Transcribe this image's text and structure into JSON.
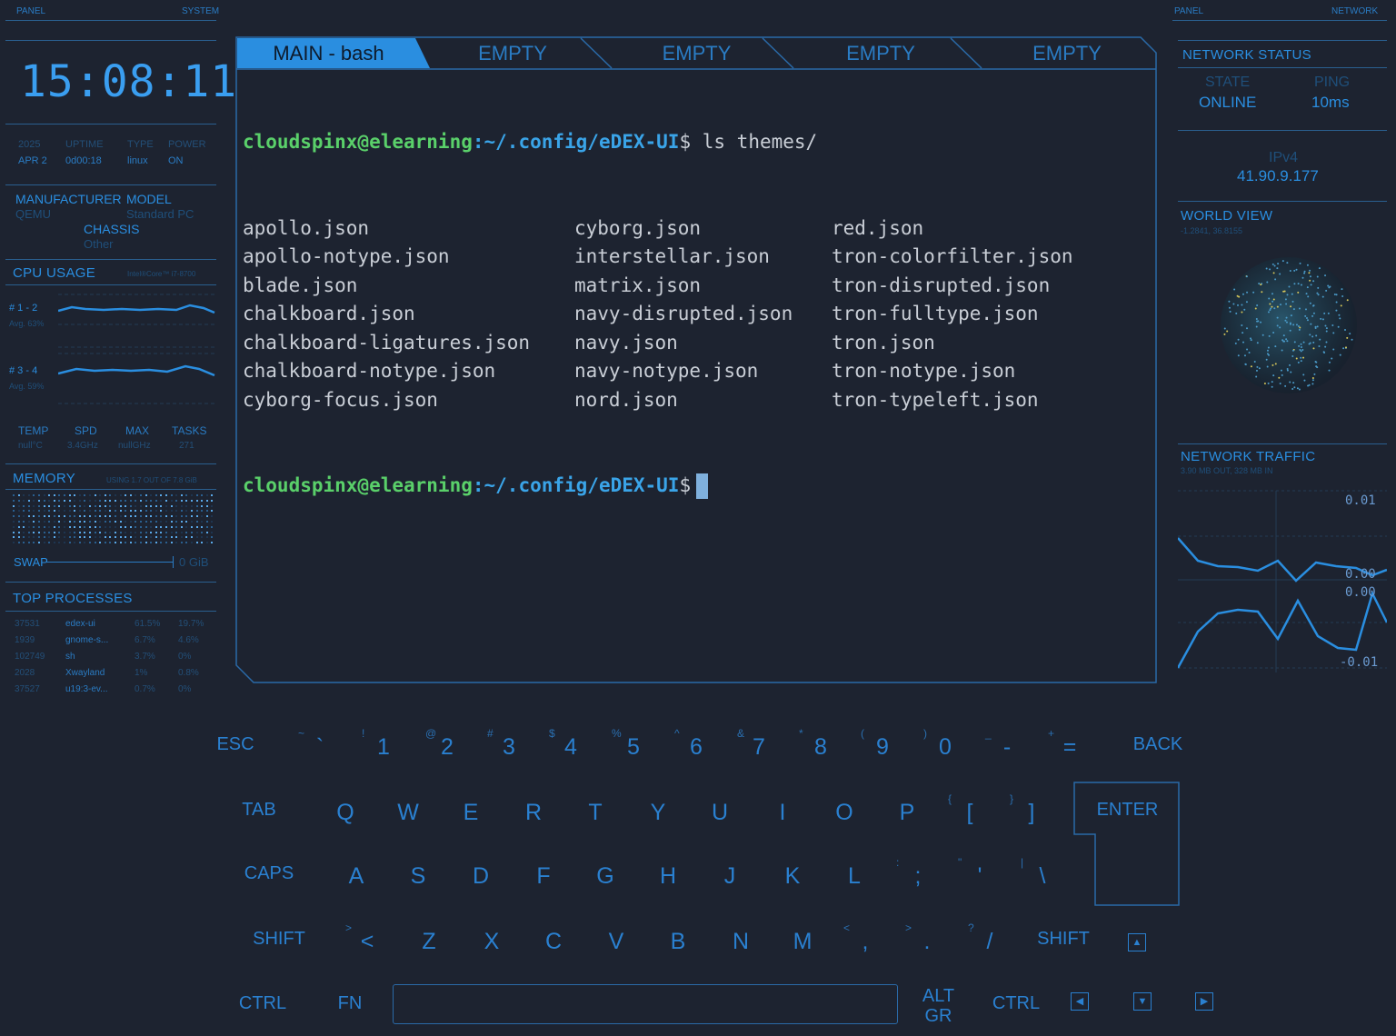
{
  "left_panel": {
    "header_left": "PANEL",
    "header_right": "SYSTEM",
    "clock": "15:08:11",
    "system_stats": [
      {
        "k": "2025",
        "v": "APR 2"
      },
      {
        "k": "UPTIME",
        "v": "0d00:18"
      },
      {
        "k": "TYPE",
        "v": "linux"
      },
      {
        "k": "POWER",
        "v": "ON"
      }
    ],
    "hardware": {
      "manufacturer_label": "MANUFACTURER",
      "manufacturer": "QEMU",
      "model_label": "MODEL",
      "model": "Standard PC",
      "chassis_label": "CHASSIS",
      "chassis": "Other"
    },
    "cpu": {
      "title": "CPU USAGE",
      "model": "Intel®Core™ i7-8700",
      "rows": [
        {
          "label": "# 1 - 2",
          "avg": "Avg. 63%"
        },
        {
          "label": "# 3 - 4",
          "avg": "Avg. 59%"
        }
      ],
      "stats": [
        {
          "k": "TEMP",
          "v": "null°C"
        },
        {
          "k": "SPD",
          "v": "3.4GHz"
        },
        {
          "k": "MAX",
          "v": "nullGHz"
        },
        {
          "k": "TASKS",
          "v": "271"
        }
      ]
    },
    "memory": {
      "title": "MEMORY",
      "usage": "USING 1.7 OUT OF 7.8 GiB",
      "swap_label": "SWAP",
      "swap_value": "0 GiB"
    },
    "processes": {
      "title": "TOP PROCESSES",
      "rows": [
        [
          "37531",
          "edex-ui",
          "61.5%",
          "19.7%"
        ],
        [
          "1939",
          "gnome-s...",
          "6.7%",
          "4.6%"
        ],
        [
          "102749",
          "sh",
          "3.7%",
          "0%"
        ],
        [
          "2028",
          "Xwayland",
          "1%",
          "0.8%"
        ],
        [
          "37527",
          "u19:3-ev...",
          "0.7%",
          "0%"
        ]
      ]
    }
  },
  "terminal": {
    "tabs": [
      "MAIN - bash",
      "EMPTY",
      "EMPTY",
      "EMPTY",
      "EMPTY"
    ],
    "prompt_user": "cloudspinx@elearning",
    "prompt_path": ":~/.config/eDEX-UI",
    "prompt_symbol": "$",
    "command": " ls themes/",
    "files_col1": [
      "apollo.json",
      "apollo-notype.json",
      "blade.json",
      "chalkboard.json",
      "chalkboard-ligatures.json",
      "chalkboard-notype.json",
      "cyborg-focus.json"
    ],
    "files_col2": [
      "cyborg.json",
      "interstellar.json",
      "matrix.json",
      "navy-disrupted.json",
      "navy.json",
      "navy-notype.json",
      "nord.json"
    ],
    "files_col3": [
      "red.json",
      "tron-colorfilter.json",
      "tron-disrupted.json",
      "tron-fulltype.json",
      "tron.json",
      "tron-notype.json",
      "tron-typeleft.json"
    ]
  },
  "right_panel": {
    "header_left": "PANEL",
    "header_right": "NETWORK",
    "status_title": "NETWORK STATUS",
    "state_label": "STATE",
    "state": "ONLINE",
    "ping_label": "PING",
    "ping": "10ms",
    "ip_label": "IPv4",
    "ip": "41.90.9.177",
    "world_title": "WORLD VIEW",
    "world_coords": "-1.2841, 36.8155",
    "traffic_title": "NETWORK TRAFFIC",
    "traffic_sub": "3.90 MB OUT, 328 MB IN",
    "traffic_ticks": [
      "0.01",
      "0.00",
      "0.00",
      "-0.01"
    ]
  },
  "keyboard": {
    "row1": [
      {
        "m": "ESC"
      },
      {
        "m": "`",
        "s": "~"
      },
      {
        "m": "1",
        "s": "!"
      },
      {
        "m": "2",
        "s": "@"
      },
      {
        "m": "3",
        "s": "#"
      },
      {
        "m": "4",
        "s": "$"
      },
      {
        "m": "5",
        "s": "%"
      },
      {
        "m": "6",
        "s": "^"
      },
      {
        "m": "7",
        "s": "&"
      },
      {
        "m": "8",
        "s": "*"
      },
      {
        "m": "9",
        "s": "("
      },
      {
        "m": "0",
        "s": ")"
      },
      {
        "m": "-",
        "s": "_"
      },
      {
        "m": "=",
        "s": "+"
      },
      {
        "m": "BACK"
      }
    ],
    "row2": [
      {
        "m": "TAB"
      },
      {
        "m": "Q"
      },
      {
        "m": "W"
      },
      {
        "m": "E"
      },
      {
        "m": "R"
      },
      {
        "m": "T"
      },
      {
        "m": "Y"
      },
      {
        "m": "U"
      },
      {
        "m": "I"
      },
      {
        "m": "O"
      },
      {
        "m": "P"
      },
      {
        "m": "[",
        "s": "{"
      },
      {
        "m": "]",
        "s": "}"
      },
      {
        "m": "ENTER"
      }
    ],
    "row3": [
      {
        "m": "CAPS"
      },
      {
        "m": "A"
      },
      {
        "m": "S"
      },
      {
        "m": "D"
      },
      {
        "m": "F"
      },
      {
        "m": "G"
      },
      {
        "m": "H"
      },
      {
        "m": "J"
      },
      {
        "m": "K"
      },
      {
        "m": "L"
      },
      {
        "m": ";",
        "s": ":"
      },
      {
        "m": "'",
        "s": "\""
      },
      {
        "m": "\\",
        "s": "|"
      }
    ],
    "row4": [
      {
        "m": "SHIFT"
      },
      {
        "m": "<",
        "s": ">"
      },
      {
        "m": "Z"
      },
      {
        "m": "X"
      },
      {
        "m": "C"
      },
      {
        "m": "V"
      },
      {
        "m": "B"
      },
      {
        "m": "N"
      },
      {
        "m": "M"
      },
      {
        "m": ",",
        "s": "<"
      },
      {
        "m": ".",
        "s": ">"
      },
      {
        "m": "/",
        "s": "?"
      },
      {
        "m": "SHIFT"
      }
    ],
    "row5": [
      {
        "m": "CTRL"
      },
      {
        "m": "FN"
      },
      {
        "m": "ALT GR"
      },
      {
        "m": "CTRL"
      }
    ]
  },
  "colors": {
    "background": "#1d2330",
    "accent": "#2a8ee0",
    "prompt_user": "#5ad06a",
    "prompt_path": "#3aa4e8"
  }
}
